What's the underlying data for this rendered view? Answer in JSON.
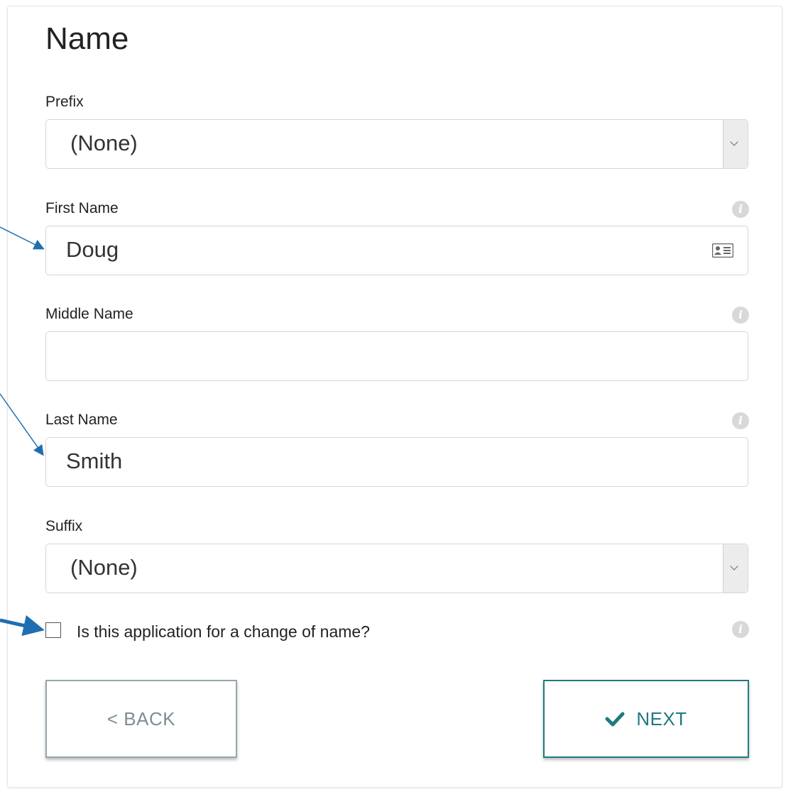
{
  "form": {
    "title": "Name",
    "prefix": {
      "label": "Prefix",
      "value": "(None)"
    },
    "first_name": {
      "label": "First Name",
      "value": "Doug"
    },
    "middle_name": {
      "label": "Middle Name",
      "value": ""
    },
    "last_name": {
      "label": "Last Name",
      "value": "Smith"
    },
    "suffix": {
      "label": "Suffix",
      "value": "(None)"
    },
    "change_of_name": {
      "label": "Is this application for a change of name?",
      "checked": false
    },
    "info_icon": "i"
  },
  "buttons": {
    "back_label": "< BACK",
    "next_label": "NEXT"
  },
  "colors": {
    "accent": "#1f7a80",
    "annotation_arrow": "#1f6fb0"
  }
}
